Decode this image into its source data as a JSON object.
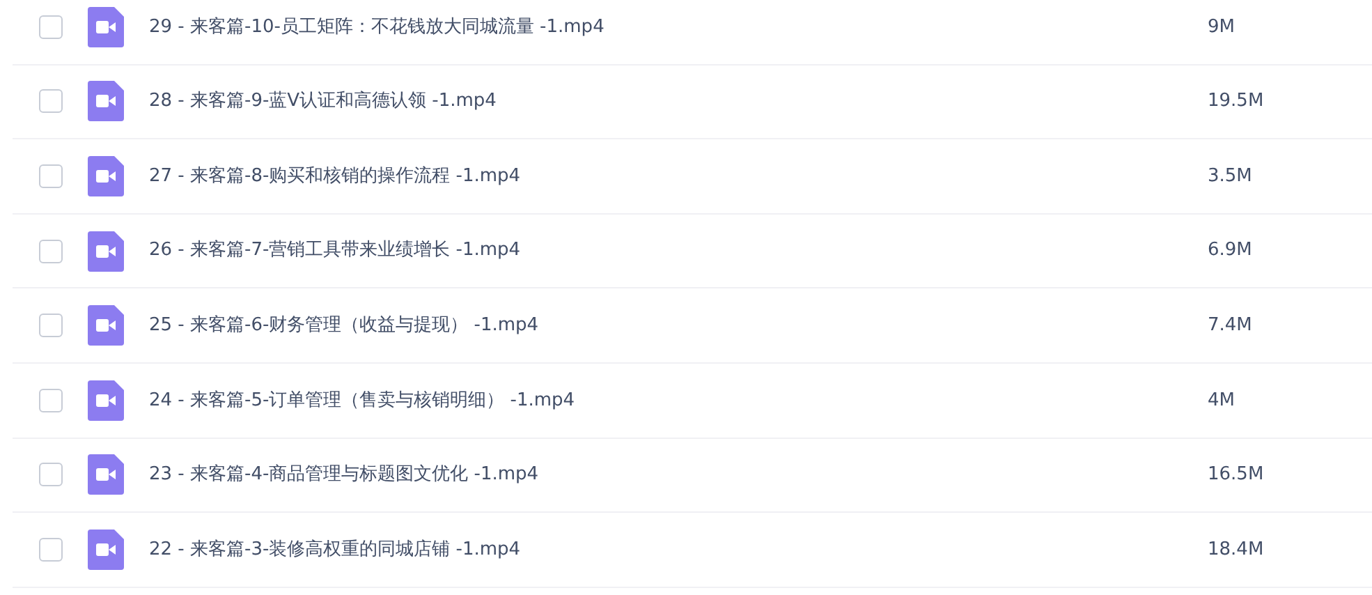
{
  "files": [
    {
      "name": "29 - 来客篇-10-员工矩阵：不花钱放大同城流量 -1.mp4",
      "size": "9M",
      "checked": false
    },
    {
      "name": "28 - 来客篇-9-蓝V认证和高德认领 -1.mp4",
      "size": "19.5M",
      "checked": false
    },
    {
      "name": "27 - 来客篇-8-购买和核销的操作流程 -1.mp4",
      "size": "3.5M",
      "checked": false
    },
    {
      "name": "26 - 来客篇-7-营销工具带来业绩增长 -1.mp4",
      "size": "6.9M",
      "checked": false
    },
    {
      "name": "25 - 来客篇-6-财务管理（收益与提现） -1.mp4",
      "size": "7.4M",
      "checked": false
    },
    {
      "name": "24 - 来客篇-5-订单管理（售卖与核销明细） -1.mp4",
      "size": "4M",
      "checked": false
    },
    {
      "name": "23 - 来客篇-4-商品管理与标题图文优化 -1.mp4",
      "size": "16.5M",
      "checked": false
    },
    {
      "name": "22 - 来客篇-3-装修高权重的同城店铺 -1.mp4",
      "size": "18.4M",
      "checked": false
    }
  ]
}
